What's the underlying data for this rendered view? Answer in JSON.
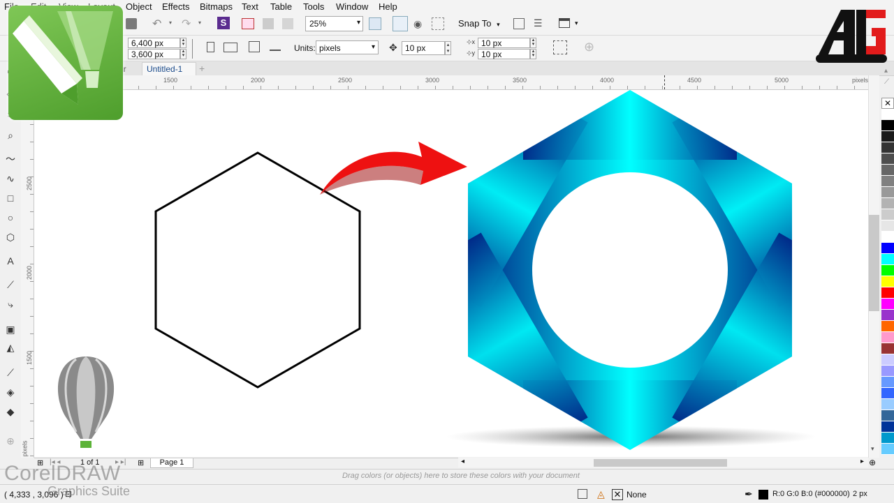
{
  "menu": [
    "File",
    "Edit",
    "View",
    "Layout",
    "Object",
    "Effects",
    "Bitmaps",
    "Text",
    "Table",
    "Tools",
    "Window",
    "Help"
  ],
  "toolbar": {
    "zoom": "25%",
    "snap_label": "Snap To"
  },
  "propbar": {
    "width": "6,400 px",
    "height": "3,600 px",
    "units_label": "Units:",
    "units_value": "pixels",
    "nudge": "10 px",
    "dup_x": "10 px",
    "dup_y": "10 px"
  },
  "tabs": [
    "dr",
    "Untitled-1"
  ],
  "ruler": {
    "h_ticks": [
      "1500",
      "2000",
      "2500",
      "3000",
      "3500",
      "4000",
      "4500",
      "5000"
    ],
    "h_unit": "pixels",
    "v_ticks": [
      "2500",
      "2000",
      "1500"
    ],
    "v_unit": "pixels"
  },
  "pagenav": {
    "count": "1 of 1",
    "page_tab": "Page 1"
  },
  "color_strip_hint": "Drag colors (or objects) here to store these colors with your document",
  "status": {
    "coords": "( 4,333 , 3,096 )",
    "fill_none": "None",
    "outline_color": "R:0 G:0 B:0 (#000000)",
    "outline_width": "2 px"
  },
  "watermark": {
    "product": "CorelDRAW",
    "suite": "Graphics Suite"
  },
  "palette": [
    "#ffffff",
    "#000000",
    "#1a1a1a",
    "#333333",
    "#4d4d4d",
    "#666666",
    "#808080",
    "#999999",
    "#b3b3b3",
    "#cccccc",
    "#e6e6e6",
    "#ffffff",
    "#0000ff",
    "#00ffff",
    "#00ff00",
    "#ffff00",
    "#ff0000",
    "#ff00ff",
    "#9933cc",
    "#ff6600",
    "#ff99cc",
    "#993333",
    "#ccccff",
    "#9999ff",
    "#6699ff",
    "#3366ff",
    "#99ccff",
    "#336699",
    "#003399",
    "#0099cc",
    "#66ccff"
  ],
  "colors": {
    "accent_green": "#5cb338",
    "arrow_red": "#ee1111",
    "ring_dark": "#001a80",
    "ring_light": "#00ffff"
  }
}
